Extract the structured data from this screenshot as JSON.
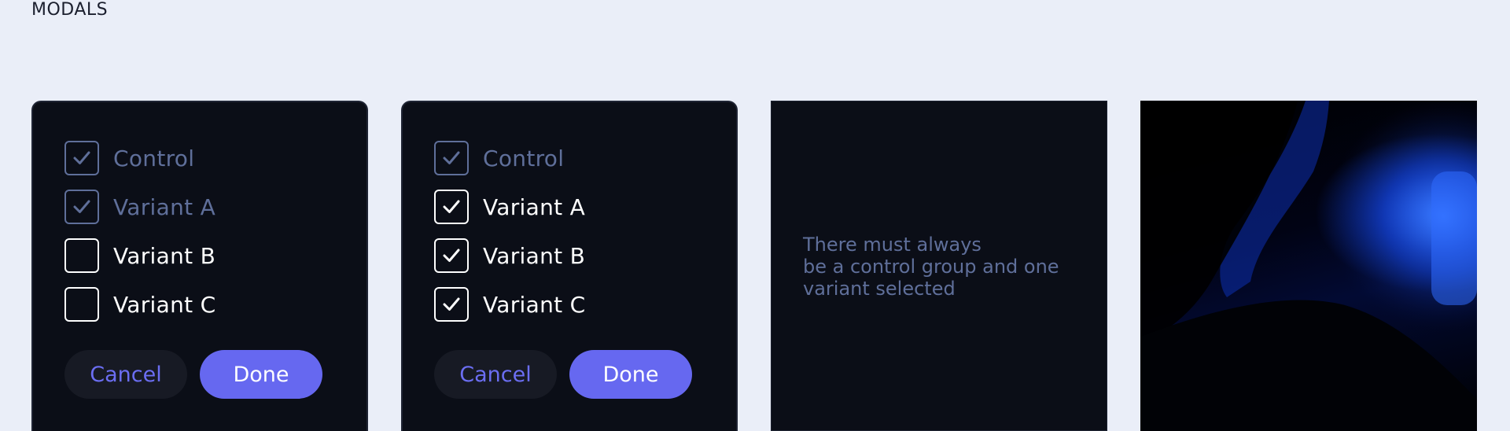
{
  "page": {
    "title": "MODALS"
  },
  "modals": [
    {
      "options": [
        {
          "label": "Control",
          "checked": true,
          "disabled": true
        },
        {
          "label": "Variant A",
          "checked": true,
          "disabled": true
        },
        {
          "label": "Variant B",
          "checked": false,
          "disabled": false
        },
        {
          "label": "Variant C",
          "checked": false,
          "disabled": false
        }
      ],
      "cancel_label": "Cancel",
      "done_label": "Done"
    },
    {
      "options": [
        {
          "label": "Control",
          "checked": true,
          "disabled": true
        },
        {
          "label": "Variant A",
          "checked": true,
          "disabled": false
        },
        {
          "label": "Variant B",
          "checked": true,
          "disabled": false
        },
        {
          "label": "Variant C",
          "checked": true,
          "disabled": false
        }
      ],
      "cancel_label": "Cancel",
      "done_label": "Done"
    },
    {
      "message": "There must always\nbe a control group and one\nvariant selected"
    }
  ],
  "colors": {
    "background": "#eaeef8",
    "card": "#0b0e17",
    "accent": "#6668f0",
    "muted": "#5f6f9a"
  }
}
